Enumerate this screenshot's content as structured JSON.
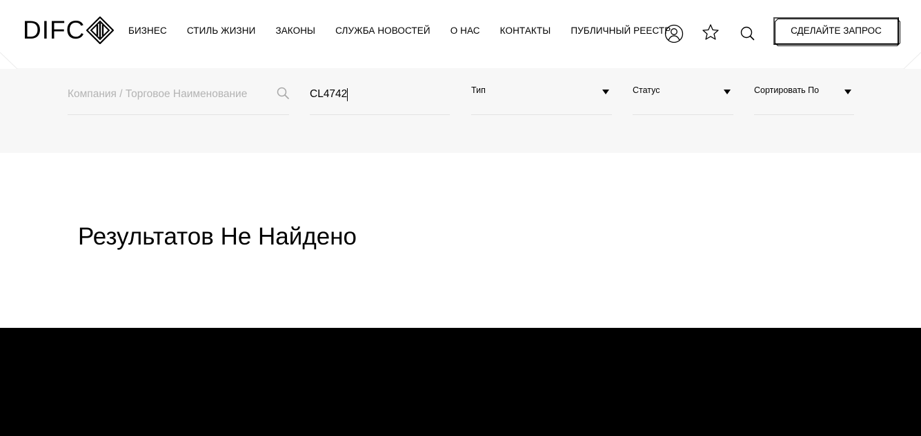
{
  "brand": {
    "logo_text": "DIFC"
  },
  "nav": {
    "items": [
      "БИЗНЕС",
      "СТИЛЬ ЖИЗНИ",
      "ЗАКОНЫ",
      "СЛУЖБА НОВОСТЕЙ",
      "О НАС",
      "КОНТАКТЫ",
      "ПУБЛИЧНЫЙ РЕЕСТР"
    ]
  },
  "header_icons": [
    "user-icon",
    "star-icon",
    "search-icon"
  ],
  "cta": {
    "label": "СДЕЛАЙТЕ ЗАПРОС"
  },
  "filters": {
    "company": {
      "placeholder": "Компания / Торговое Наименование",
      "value": ""
    },
    "registration": {
      "value": "CL4742"
    },
    "type": {
      "label": "Тип"
    },
    "status": {
      "label": "Статус"
    },
    "sort": {
      "label": "Сортировать По"
    }
  },
  "results": {
    "message": "Результатов Не Найдено"
  },
  "colors": {
    "filter_background": "#f7f7f7",
    "footer_background": "#000000",
    "placeholder_text": "#b3b3b3"
  }
}
